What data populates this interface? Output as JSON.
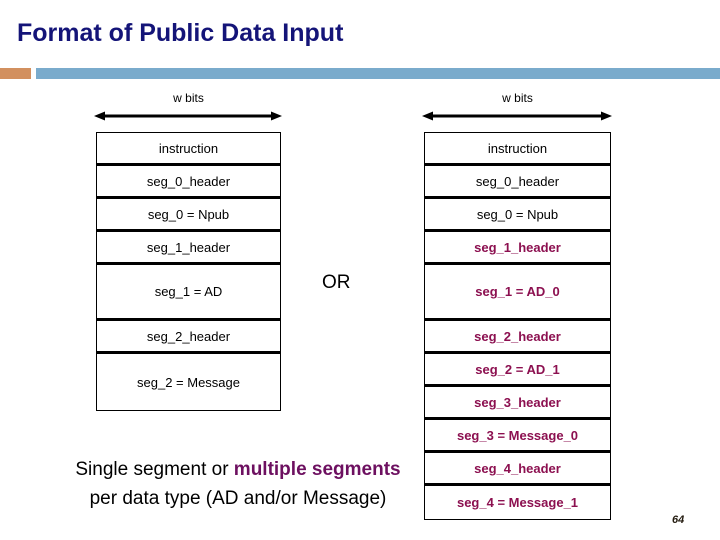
{
  "slide": {
    "title": "Format of Public Data Input",
    "page_number": "64",
    "accent_color": "#8c1050",
    "title_color": "#141478",
    "divider_accent_color": "#d2905f",
    "divider_bar_color": "#7aabcc"
  },
  "separator": {
    "or_label": "OR"
  },
  "left_diagram": {
    "width_label": "w bits",
    "rows": [
      {
        "label": "instruction",
        "accent": false,
        "tall": false
      },
      {
        "label": "seg_0_header",
        "accent": false,
        "tall": false
      },
      {
        "label": "seg_0 = Npub",
        "accent": false,
        "tall": false
      },
      {
        "label": "seg_1_header",
        "accent": false,
        "tall": false
      },
      {
        "label": "seg_1 = AD",
        "accent": false,
        "tall": true
      },
      {
        "label": "seg_2_header",
        "accent": false,
        "tall": false
      },
      {
        "label": "seg_2 = Message",
        "accent": false,
        "tall": true
      }
    ]
  },
  "right_diagram": {
    "width_label": "w bits",
    "rows": [
      {
        "label": "instruction",
        "accent": false,
        "tall": false
      },
      {
        "label": "seg_0_header",
        "accent": false,
        "tall": false
      },
      {
        "label": "seg_0 = Npub",
        "accent": false,
        "tall": false
      },
      {
        "label": "seg_1_header",
        "accent": true,
        "tall": false
      },
      {
        "label": "seg_1 = AD_0",
        "accent": true,
        "tall": true
      },
      {
        "label": "seg_2_header",
        "accent": true,
        "tall": false
      },
      {
        "label": "seg_2 = AD_1",
        "accent": true,
        "tall": false
      },
      {
        "label": "seg_3_header",
        "accent": true,
        "tall": false
      },
      {
        "label": "seg_3 = Message_0",
        "accent": true,
        "tall": false
      },
      {
        "label": "seg_4_header",
        "accent": true,
        "tall": false
      },
      {
        "label": "seg_4 = Message_1",
        "accent": true,
        "tall": false
      }
    ]
  },
  "caption": {
    "line1_part1": "Single segment or ",
    "line1_highlight": "multiple segments",
    "line2": "per data type (AD and/or Message)"
  }
}
